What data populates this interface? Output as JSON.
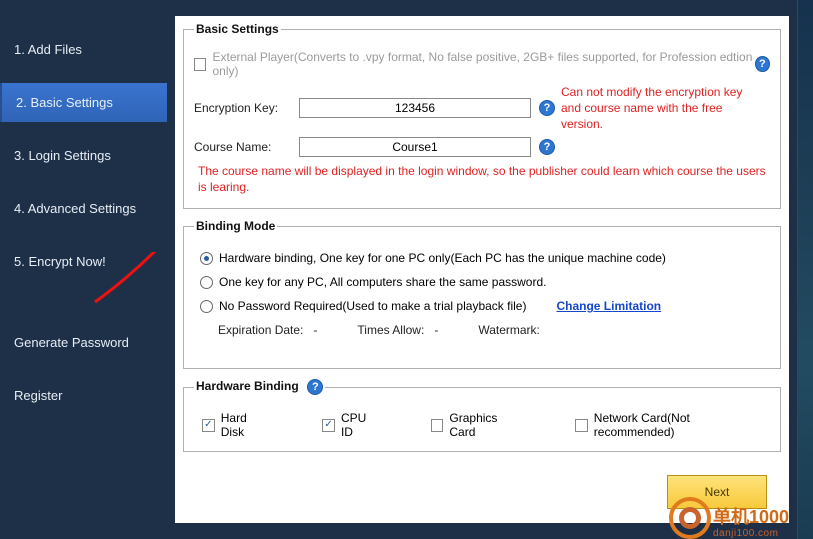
{
  "sidebar": {
    "items": [
      {
        "label": "1. Add Files"
      },
      {
        "label": "2. Basic Settings"
      },
      {
        "label": "3. Login Settings"
      },
      {
        "label": "4. Advanced Settings"
      },
      {
        "label": "5. Encrypt Now!"
      }
    ],
    "links": [
      {
        "label": "Generate Password"
      },
      {
        "label": "Register"
      }
    ]
  },
  "basic": {
    "legend": "Basic Settings",
    "external_player": "External Player(Converts to .vpy format, No false positive, 2GB+ files supported, for Profession edtion only)",
    "encryption_key_label": "Encryption Key:",
    "encryption_key_value": "123456",
    "course_name_label": "Course Name:",
    "course_name_value": "Course1",
    "free_warning": "Can not modify the encryption key and course name with the free version.",
    "course_note": "The course name will be displayed in the login window, so the publisher could learn which course the users is learing."
  },
  "binding": {
    "legend": "Binding Mode",
    "opt_hardware": "Hardware binding, One key for one PC only(Each PC has the unique machine code)",
    "opt_anypc": "One key for any PC, All computers share the same password.",
    "opt_nopass": "No Password Required(Used to make a trial playback file)",
    "change_limitation": "Change Limitation",
    "expiration_label": "Expiration Date:",
    "expiration_value": "-",
    "times_label": "Times Allow:",
    "times_value": "-",
    "watermark_label": "Watermark:"
  },
  "hardware": {
    "legend": "Hardware Binding",
    "hard_disk": "Hard Disk",
    "cpu_id": "CPU ID",
    "graphics_card": "Graphics Card",
    "network_card": "Network Card(Not recommended)"
  },
  "footer": {
    "next": "Next"
  },
  "logo": {
    "line1": "单机1000",
    "line2": "danji100.com"
  }
}
